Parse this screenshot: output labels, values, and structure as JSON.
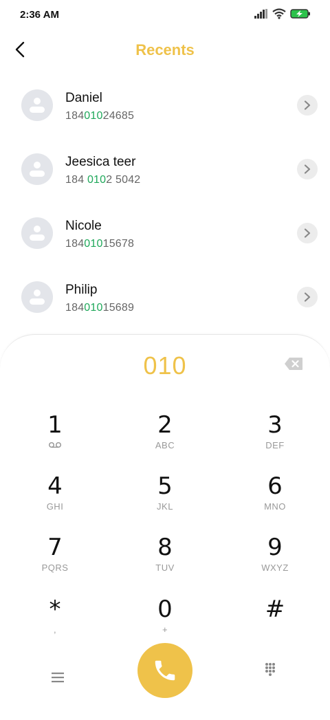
{
  "status": {
    "time": "2:36 AM"
  },
  "header": {
    "title": "Recents"
  },
  "contacts": [
    {
      "name": "Daniel",
      "number_parts": [
        "184",
        "010",
        "24685"
      ]
    },
    {
      "name": "Jeesica teer",
      "number_parts": [
        "184 ",
        "010",
        "2 5042"
      ]
    },
    {
      "name": "Nicole",
      "number_parts": [
        "184",
        "010",
        "15678"
      ]
    },
    {
      "name": "Philip",
      "number_parts": [
        "184",
        "010",
        "15689"
      ]
    }
  ],
  "dialer": {
    "input": "010",
    "keys": [
      {
        "digit": "1",
        "letters": ""
      },
      {
        "digit": "2",
        "letters": "ABC"
      },
      {
        "digit": "3",
        "letters": "DEF"
      },
      {
        "digit": "4",
        "letters": "GHI"
      },
      {
        "digit": "5",
        "letters": "JKL"
      },
      {
        "digit": "6",
        "letters": "MNO"
      },
      {
        "digit": "7",
        "letters": "PQRS"
      },
      {
        "digit": "8",
        "letters": "TUV"
      },
      {
        "digit": "9",
        "letters": "WXYZ"
      },
      {
        "digit": "*",
        "letters": ","
      },
      {
        "digit": "0",
        "letters": "+"
      },
      {
        "digit": "#",
        "letters": ""
      }
    ]
  },
  "colors": {
    "accent": "#efc24a",
    "highlight": "#1fa85a"
  },
  "icons": {
    "back": "chevron-left-icon",
    "chevron": "chevron-right-icon",
    "backspace": "backspace-icon",
    "voicemail": "voicemail-icon",
    "menu": "menu-icon",
    "call": "phone-icon",
    "keypad": "keypad-grid-icon"
  }
}
